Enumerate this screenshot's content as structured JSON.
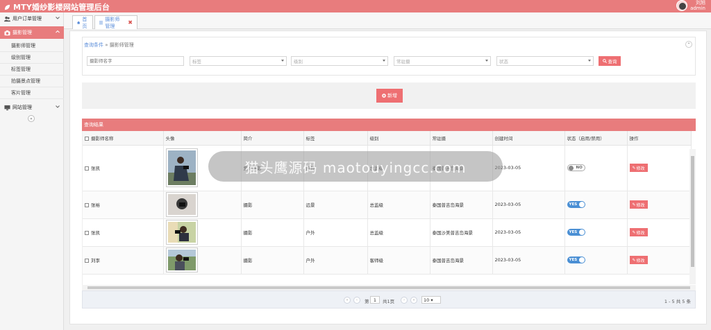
{
  "header": {
    "title": "MTY婚纱影楼网站管理后台",
    "user_name": "刘旭",
    "user_role": "admin"
  },
  "sidebar": {
    "groups": [
      {
        "label": "用户订单管理",
        "icon": "users-icon",
        "expanded": false
      },
      {
        "label": "摄影管理",
        "icon": "camera-icon",
        "expanded": true,
        "items": [
          "摄影师管理",
          "级别管理",
          "标签管理",
          "拍摄景点管理",
          "客片管理"
        ]
      },
      {
        "label": "网站管理",
        "icon": "monitor-icon",
        "expanded": false
      }
    ],
    "collapse_symbol": "«"
  },
  "tabs": [
    {
      "label": "首页",
      "icon": "home-icon"
    },
    {
      "label": "摄影师管理",
      "icon": "settings-icon",
      "closable": true
    }
  ],
  "query": {
    "title": "查询条件",
    "breadcrumb": "» 摄影师管理",
    "name_placeholder": "摄影师名字",
    "tag_placeholder": "标签",
    "level_placeholder": "级别",
    "station_placeholder": "常驻摄",
    "status_placeholder": "状态",
    "search_label": "查询"
  },
  "actions": {
    "add_label": "新增"
  },
  "results": {
    "title": "查询结果",
    "columns": [
      "摄影师名称",
      "头像",
      "简介",
      "标签",
      "级别",
      "常驻摄",
      "创建时间",
      "状态（启用/禁用）",
      "操作"
    ],
    "rows": [
      {
        "name": "张凯",
        "intro": "爱好摄影",
        "tag": "户外",
        "level": "总监级",
        "station": "泰国普吉岛海景",
        "created": "2023-03-05",
        "status": "NO",
        "enabled": false
      },
      {
        "name": "张裕",
        "intro": "摄影",
        "tag": "远景",
        "level": "总监级",
        "station": "泰国普吉岛海景",
        "created": "2023-03-05",
        "status": "YES",
        "enabled": true
      },
      {
        "name": "张凯",
        "intro": "摄影",
        "tag": "户外",
        "level": "总监级",
        "station": "泰国沙美普吉岛海景",
        "created": "2023-03-05",
        "status": "YES",
        "enabled": true
      },
      {
        "name": "刘李",
        "intro": "摄影",
        "tag": "户外",
        "level": "客师级",
        "station": "泰国普吉岛海景",
        "created": "2023-03-05",
        "status": "YES",
        "enabled": true
      }
    ],
    "edit_label": "修改"
  },
  "pager": {
    "page": "1",
    "total_pages_text": "共1页",
    "page_size": "10",
    "range_text": "1 - 5  共 5 条",
    "page_prefix": "第"
  },
  "watermark": "猫头鹰源码 maotouyingcc.com",
  "colors": {
    "accent": "#e87c7d",
    "button": "#ee6f72",
    "toggle_on": "#4a8fd4"
  }
}
